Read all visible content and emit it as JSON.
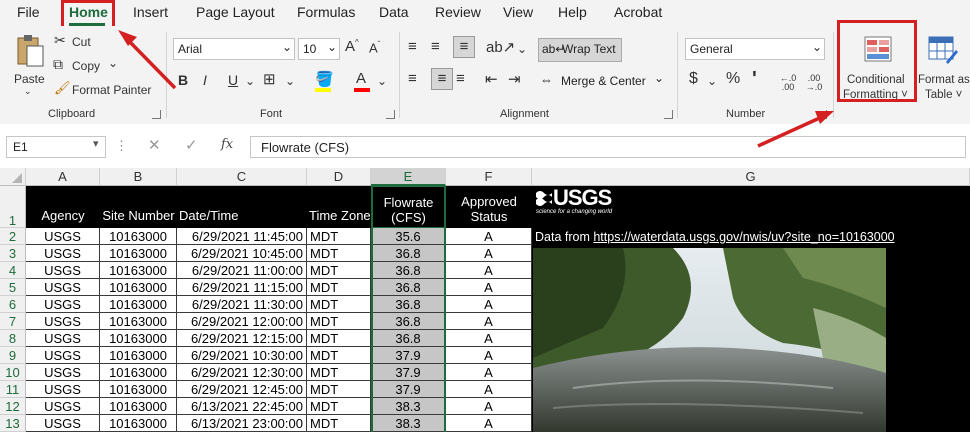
{
  "menu": [
    "File",
    "Home",
    "Insert",
    "Page Layout",
    "Formulas",
    "Data",
    "Review",
    "View",
    "Help",
    "Acrobat"
  ],
  "clipboard": {
    "paste": "Paste",
    "cut": "Cut",
    "copy": "Copy",
    "format_painter": "Format Painter",
    "title": "Clipboard"
  },
  "font": {
    "name": "Arial",
    "size": "10",
    "bold": "B",
    "italic": "I",
    "underline": "U",
    "title": "Font"
  },
  "alignment": {
    "wrap": "Wrap Text",
    "merge": "Merge & Center",
    "title": "Alignment"
  },
  "number": {
    "format": "General",
    "currency": "$",
    "percent": "%",
    "comma": "'",
    "inc": "←.0 .00",
    "dec": ".00 →.0",
    "title": "Number"
  },
  "styles": {
    "cond_line1": "Conditional",
    "cond_line2": "Formatting ˅",
    "table_line1": "Format as",
    "table_line2": "Table ˅"
  },
  "formula_bar": {
    "name_box": "E1",
    "fx": "fx",
    "content": "Flowrate (CFS)"
  },
  "columns": [
    "A",
    "B",
    "C",
    "D",
    "E",
    "F",
    "G"
  ],
  "headers": {
    "agency": "Agency",
    "site": "Site Number",
    "datetime": "Date/Time",
    "tz": "Time Zone",
    "flow1": "Flowrate",
    "flow2": "(CFS)",
    "status1": "Approved",
    "status2": "Status"
  },
  "rows": [
    {
      "n": "1"
    },
    {
      "n": "2",
      "agency": "USGS",
      "site": "10163000",
      "dt": "6/29/2021 11:45:00",
      "tz": "MDT",
      "flow": "35.6",
      "status": "A"
    },
    {
      "n": "3",
      "agency": "USGS",
      "site": "10163000",
      "dt": "6/29/2021 10:45:00",
      "tz": "MDT",
      "flow": "36.8",
      "status": "A"
    },
    {
      "n": "4",
      "agency": "USGS",
      "site": "10163000",
      "dt": "6/29/2021 11:00:00",
      "tz": "MDT",
      "flow": "36.8",
      "status": "A"
    },
    {
      "n": "5",
      "agency": "USGS",
      "site": "10163000",
      "dt": "6/29/2021 11:15:00",
      "tz": "MDT",
      "flow": "36.8",
      "status": "A"
    },
    {
      "n": "6",
      "agency": "USGS",
      "site": "10163000",
      "dt": "6/29/2021 11:30:00",
      "tz": "MDT",
      "flow": "36.8",
      "status": "A"
    },
    {
      "n": "7",
      "agency": "USGS",
      "site": "10163000",
      "dt": "6/29/2021 12:00:00",
      "tz": "MDT",
      "flow": "36.8",
      "status": "A"
    },
    {
      "n": "8",
      "agency": "USGS",
      "site": "10163000",
      "dt": "6/29/2021 12:15:00",
      "tz": "MDT",
      "flow": "36.8",
      "status": "A"
    },
    {
      "n": "9",
      "agency": "USGS",
      "site": "10163000",
      "dt": "6/29/2021 10:30:00",
      "tz": "MDT",
      "flow": "37.9",
      "status": "A"
    },
    {
      "n": "10",
      "agency": "USGS",
      "site": "10163000",
      "dt": "6/29/2021 12:30:00",
      "tz": "MDT",
      "flow": "37.9",
      "status": "A"
    },
    {
      "n": "11",
      "agency": "USGS",
      "site": "10163000",
      "dt": "6/29/2021 12:45:00",
      "tz": "MDT",
      "flow": "37.9",
      "status": "A"
    },
    {
      "n": "12",
      "agency": "USGS",
      "site": "10163000",
      "dt": "6/13/2021 22:45:00",
      "tz": "MDT",
      "flow": "38.3",
      "status": "A"
    },
    {
      "n": "13",
      "agency": "USGS",
      "site": "10163000",
      "dt": "6/13/2021 23:00:00",
      "tz": "MDT",
      "flow": "38.3",
      "status": "A"
    }
  ],
  "usgs": {
    "logo": "USGS",
    "tagline": "science for a changing world",
    "data_prefix": "Data from ",
    "data_link": "https://waterdata.usgs.gov/nwis/uv?site_no=10163000"
  },
  "colors": {
    "accent": "#1e6b3c",
    "annotation": "#d42020",
    "sheet_bg": "#000000",
    "selected_col": "#c6c6c6"
  }
}
